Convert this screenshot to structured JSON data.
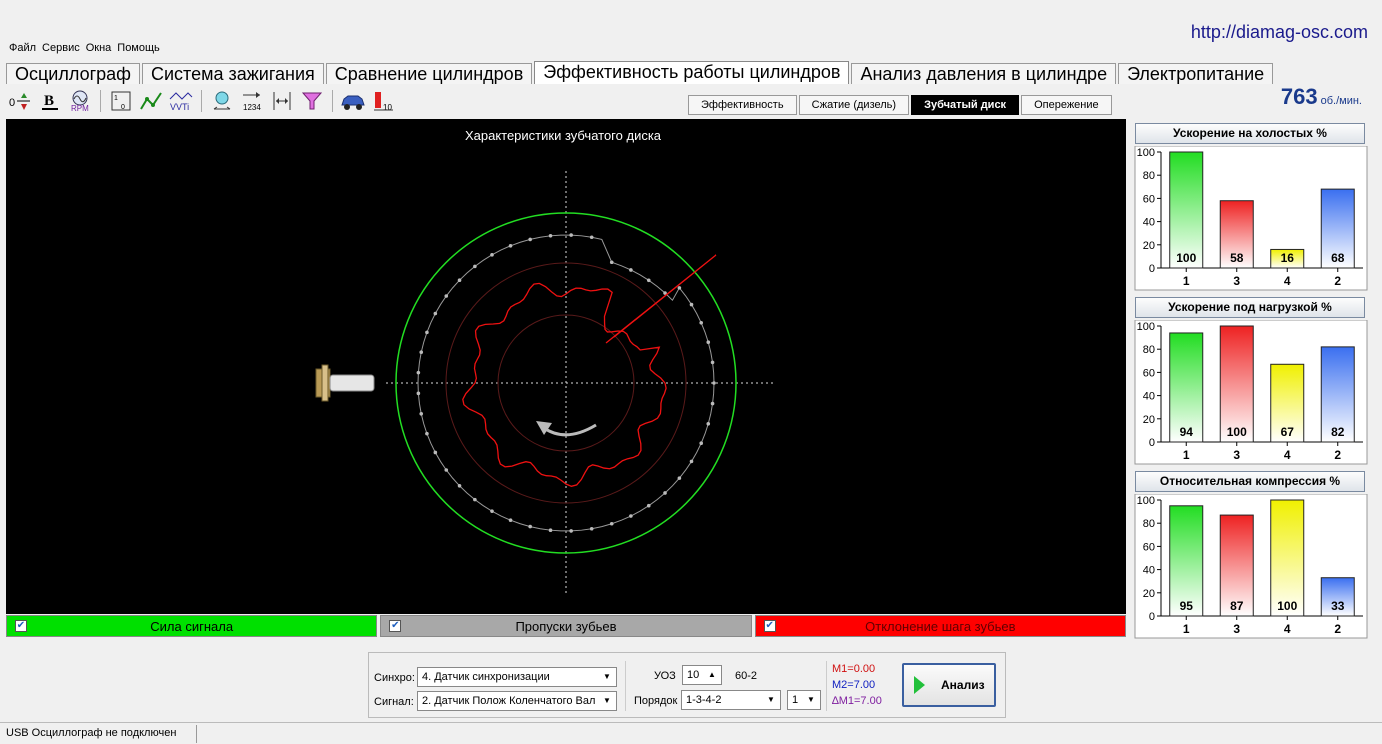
{
  "site_url": "http://diamag-osc.com",
  "menu": [
    "Файл",
    "Сервис",
    "Окна",
    "Помощь"
  ],
  "main_tabs": [
    "Осциллограф",
    "Система зажигания",
    "Сравнение цилиндров",
    "Эффективность работы цилиндров",
    "Анализ давления в цилиндре",
    "Электропитание"
  ],
  "active_main_tab": 3,
  "sub_tabs": [
    "Эффективность",
    "Сжатие (дизель)",
    "Зубчатый диск",
    "Опережение"
  ],
  "active_sub_tab": 2,
  "toolbar_icons": [
    "zero-offset-icon",
    "bold-icon",
    "rpm-icon",
    "scale-icon",
    "trend-icon",
    "vvti-icon",
    "sensor-icon",
    "sequence-icon",
    "range-icon",
    "filter-icon",
    "car-icon",
    "cylinder-count-icon"
  ],
  "rpm": {
    "value": "763",
    "unit": "об./мин."
  },
  "scope": {
    "title": "Характеристики зубчатого диска"
  },
  "legend": [
    {
      "label": "Сила сигнала",
      "color": "#00e000",
      "checked": true
    },
    {
      "label": "Пропуски зубьев",
      "color": "#a8a8a8",
      "checked": true
    },
    {
      "label": "Отклонение шага зубьев",
      "color": "#ff0000",
      "checked": true
    }
  ],
  "chart_data": [
    {
      "type": "bar",
      "title": "Ускорение на холостых %",
      "categories": [
        "1",
        "3",
        "4",
        "2"
      ],
      "values": [
        100,
        58,
        16,
        68
      ],
      "ylim": [
        0,
        100
      ],
      "yticks": [
        0,
        20,
        40,
        60,
        80,
        100
      ],
      "colors": [
        "#22dd22",
        "#ee2222",
        "#f0f000",
        "#3a6ff0"
      ]
    },
    {
      "type": "bar",
      "title": "Ускорение под нагрузкой %",
      "categories": [
        "1",
        "3",
        "4",
        "2"
      ],
      "values": [
        94,
        100,
        67,
        82
      ],
      "ylim": [
        0,
        100
      ],
      "yticks": [
        0,
        20,
        40,
        60,
        80,
        100
      ],
      "colors": [
        "#22dd22",
        "#ee2222",
        "#f0f000",
        "#3a6ff0"
      ]
    },
    {
      "type": "bar",
      "title": "Относительная компрессия %",
      "categories": [
        "1",
        "3",
        "4",
        "2"
      ],
      "values": [
        95,
        87,
        100,
        33
      ],
      "ylim": [
        0,
        100
      ],
      "yticks": [
        0,
        20,
        40,
        60,
        80,
        100
      ],
      "colors": [
        "#22dd22",
        "#ee2222",
        "#f0f000",
        "#3a6ff0"
      ]
    }
  ],
  "controls": {
    "sync_label": "Синхро:",
    "sync_value": "4.  Датчик синхронизации",
    "signal_label": "Сигнал:",
    "signal_value": "2.  Датчик Полож Коленчатого Вал",
    "uoz_label": "УОЗ",
    "uoz_value": "10",
    "teeth": "60-2",
    "order_label": "Порядок",
    "order_value": "1-3-4-2",
    "order_index": "1",
    "m1": "M1=0.00",
    "m2": "M2=7.00",
    "dm1": "∆M1=7.00",
    "analyze_label": "Анализ"
  },
  "status": "USB Осциллограф не подключен"
}
